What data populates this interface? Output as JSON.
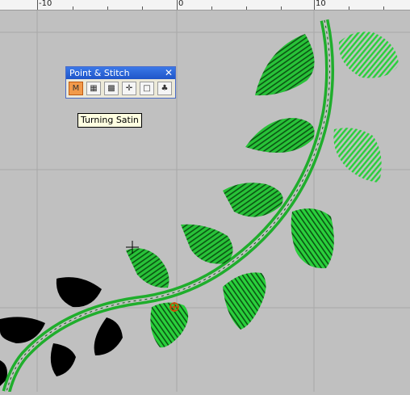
{
  "ruler": {
    "labels": [
      "-10",
      "0",
      "10"
    ]
  },
  "toolbar": {
    "title": "Point & Stitch",
    "close_symbol": "✕",
    "buttons": [
      {
        "icon": "turning-satin-icon",
        "glyph": "M",
        "active": true
      },
      {
        "icon": "fill-stitch-icon",
        "glyph": "▦",
        "active": false
      },
      {
        "icon": "pattern-fill-icon",
        "glyph": "▩",
        "active": false
      },
      {
        "icon": "point-crosshair-icon",
        "glyph": "✛",
        "active": false
      },
      {
        "icon": "blank-shape-icon",
        "glyph": "□",
        "active": false
      },
      {
        "icon": "tree-stitch-icon",
        "glyph": "♣",
        "active": false
      }
    ]
  },
  "tooltip": {
    "text": "Turning Satin"
  },
  "colors": {
    "background": "#c0c0c0",
    "grid": "#a9a9a9",
    "stitch_green": "#1fae2c",
    "stitch_dark": "#0d5c14",
    "black_shape": "#000000",
    "accent_orange": "#f29a4a"
  }
}
